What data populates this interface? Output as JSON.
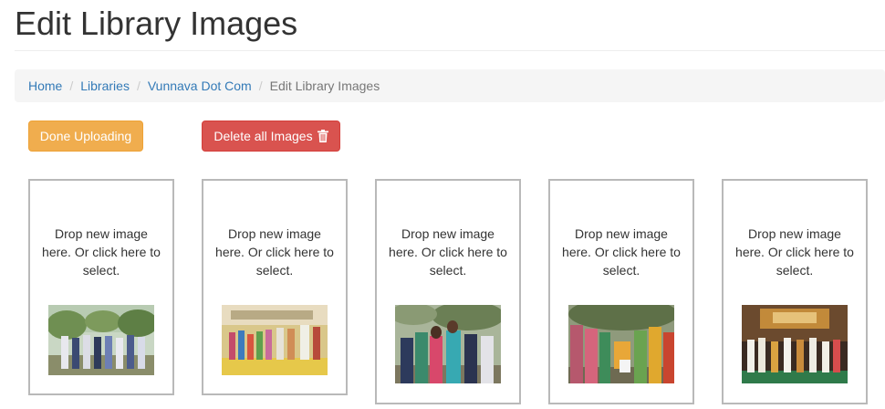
{
  "page": {
    "title": "Edit Library Images"
  },
  "breadcrumb": [
    {
      "label": "Home"
    },
    {
      "label": "Libraries"
    },
    {
      "label": "Vunnava Dot Com"
    },
    {
      "label": "Edit Library Images"
    }
  ],
  "breadcrumb_separator": "/",
  "buttons": {
    "done_label": "Done Uploading",
    "delete_label": "Delete all Images",
    "delete_icon": "trash-icon"
  },
  "cards": [
    {
      "drop_text": "Drop new image here. Or click here to select."
    },
    {
      "drop_text": "Drop new image here. Or click here to select."
    },
    {
      "drop_text": "Drop new image here. Or click here to select."
    },
    {
      "drop_text": "Drop new image here. Or click here to select."
    },
    {
      "drop_text": "Drop new image here. Or click here to select."
    }
  ],
  "colors": {
    "link": "#337ab7",
    "warning": "#f0ad4e",
    "danger": "#d9534f",
    "card_border": "#b9b9b9",
    "breadcrumb_bg": "#f5f5f5"
  }
}
